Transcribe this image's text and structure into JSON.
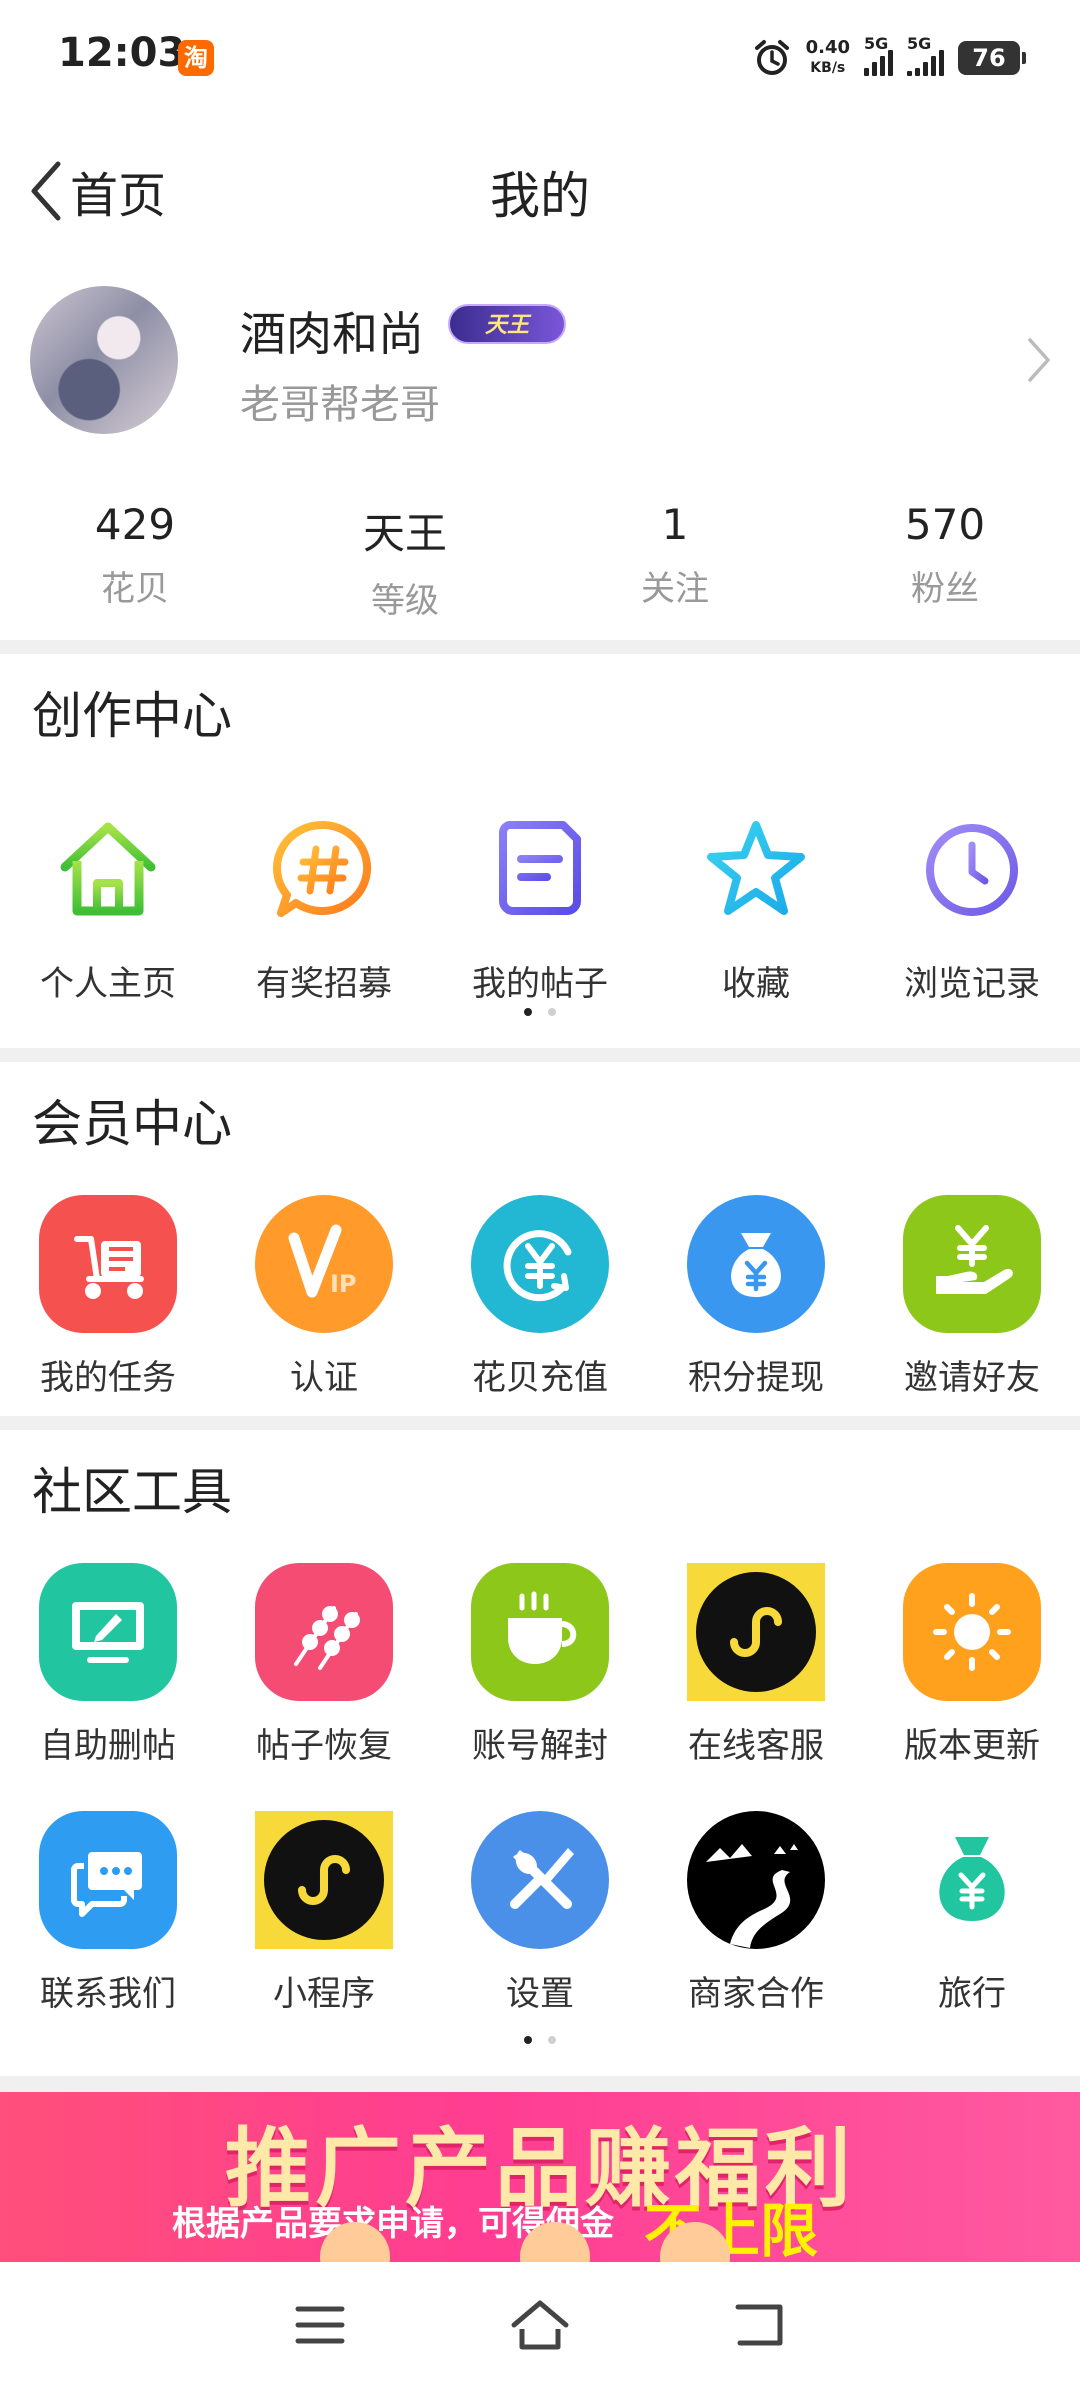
{
  "status_bar": {
    "time": "12:03",
    "app_badge": "淘",
    "net_speed_value": "0.40",
    "net_speed_unit": "KB/s",
    "sim1": "5G",
    "sim2": "5G",
    "battery": "76"
  },
  "header": {
    "back_label": "首页",
    "title": "我的"
  },
  "profile": {
    "username": "酒肉和尚",
    "level_badge": "天王",
    "signature": "老哥帮老哥"
  },
  "stats": [
    {
      "value": "429",
      "label": "花贝"
    },
    {
      "value": "天王",
      "label": "等级"
    },
    {
      "value": "1",
      "label": "关注"
    },
    {
      "value": "570",
      "label": "粉丝"
    }
  ],
  "creation_center": {
    "title": "创作中心",
    "items": [
      {
        "label": "个人主页",
        "icon": "house-icon"
      },
      {
        "label": "有奖招募",
        "icon": "hashtag-bubble-icon"
      },
      {
        "label": "我的帖子",
        "icon": "document-icon"
      },
      {
        "label": "收藏",
        "icon": "star-icon"
      },
      {
        "label": "浏览记录",
        "icon": "clock-icon"
      }
    ]
  },
  "member_center": {
    "title": "会员中心",
    "items": [
      {
        "label": "我的任务",
        "icon": "scooter-task-icon",
        "color": "#f5524f"
      },
      {
        "label": "认证",
        "icon": "vip-icon",
        "color": "#ff9a2b"
      },
      {
        "label": "花贝充值",
        "icon": "yuan-recharge-icon",
        "color": "#22b7d3"
      },
      {
        "label": "积分提现",
        "icon": "money-bag-icon",
        "color": "#3a97f0"
      },
      {
        "label": "邀请好友",
        "icon": "hand-yuan-icon",
        "color": "#8cc71a"
      }
    ]
  },
  "community_tools": {
    "title": "社区工具",
    "row1": [
      {
        "label": "自助删帖",
        "icon": "monitor-edit-icon",
        "color": "#21c6a1"
      },
      {
        "label": "帖子恢复",
        "icon": "skewer-icon",
        "color": "#f54c74"
      },
      {
        "label": "账号解封",
        "icon": "coffee-cup-icon",
        "color": "#8cc71a"
      },
      {
        "label": "在线客服",
        "icon": "mini-program-icon",
        "color": "#f7d93a"
      },
      {
        "label": "版本更新",
        "icon": "sun-icon",
        "color": "#ffa11c"
      }
    ],
    "row2": [
      {
        "label": "联系我们",
        "icon": "chat-bubbles-icon",
        "color": "#2e9cf0"
      },
      {
        "label": "小程序",
        "icon": "mini-program-icon",
        "color": "#f7d93a"
      },
      {
        "label": "设置",
        "icon": "tools-icon",
        "color": "#4a8fe8"
      },
      {
        "label": "商家合作",
        "icon": "mountain-road-icon",
        "color": "#000000"
      },
      {
        "label": "旅行",
        "icon": "money-bag-icon",
        "color": "#21c6a1"
      }
    ]
  },
  "banner": {
    "title": "推广产品赚福利",
    "subtitle": "根据产品要求申请，可得佣金",
    "highlight": "不上限"
  }
}
